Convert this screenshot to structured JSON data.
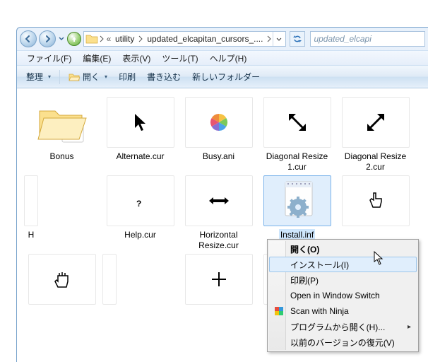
{
  "breadcrumb": {
    "level1": "utility",
    "level2": "updated_elcapitan_cursors_...."
  },
  "search": {
    "placeholder": "updated_elcapi"
  },
  "menubar": {
    "file": "ファイル(F)",
    "edit": "編集(E)",
    "view": "表示(V)",
    "tools": "ツール(T)",
    "help": "ヘルプ(H)"
  },
  "toolbar": {
    "organize": "整理",
    "open": "開く",
    "print": "印刷",
    "burn": "書き込む",
    "newfolder": "新しいフォルダー"
  },
  "items": [
    {
      "name": "Bonus"
    },
    {
      "name": "Alternate.cur"
    },
    {
      "name": "Busy.ani"
    },
    {
      "name": "Diagonal Resize 1.cur"
    },
    {
      "name": "Diagonal Resize 2.cur"
    },
    {
      "name": "H"
    },
    {
      "name": "Help.cur"
    },
    {
      "name": "Horizontal Resize.cur"
    },
    {
      "name": "Install.inf"
    },
    {
      "name": ""
    },
    {
      "name": ""
    },
    {
      "name": ""
    },
    {
      "name": ""
    },
    {
      "name": ""
    },
    {
      "name": ""
    }
  ],
  "contextmenu": {
    "open": "開く(O)",
    "install": "インストール(I)",
    "print": "印刷(P)",
    "owswitch": "Open in Window Switch",
    "ninja": "Scan with Ninja",
    "openwith": "プログラムから開く(H)...",
    "restore": "以前のバージョンの復元(V)"
  }
}
